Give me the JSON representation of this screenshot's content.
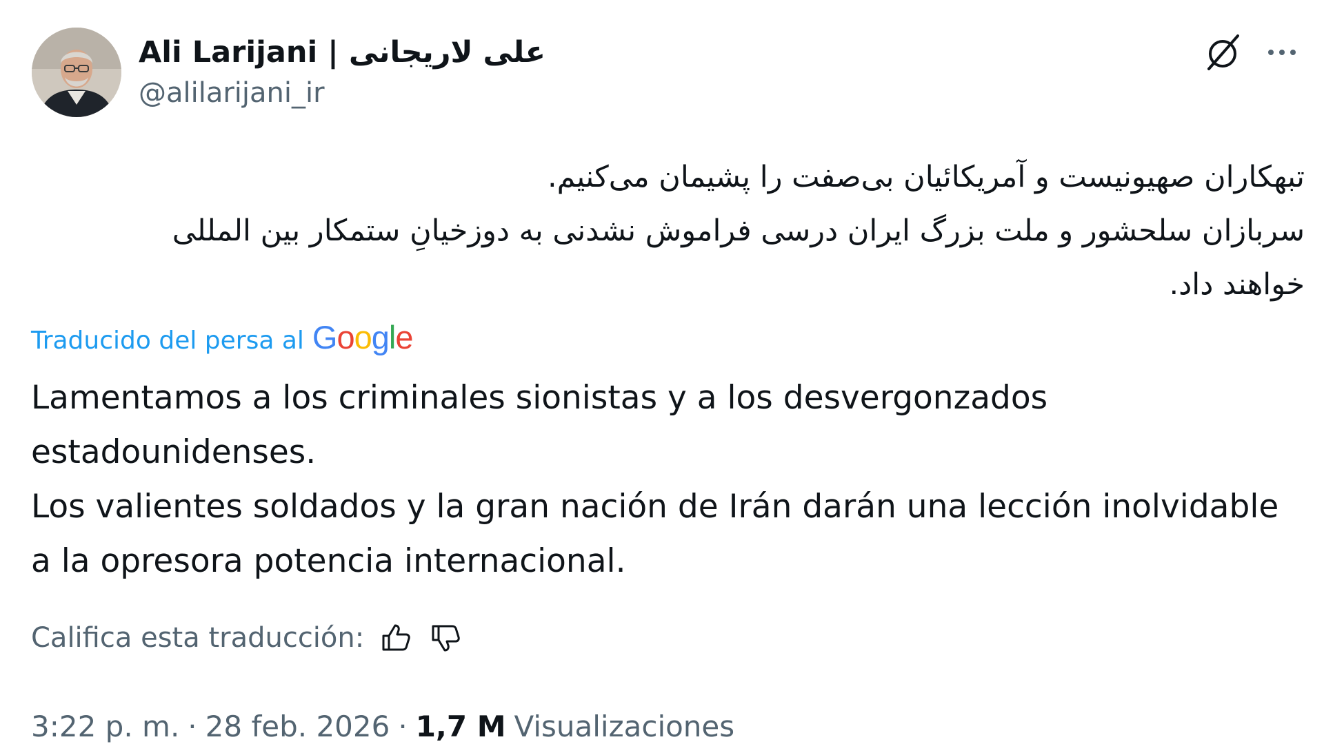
{
  "author": {
    "display_name": "Ali Larijani | علی لاریجانی",
    "handle": "@alilarijani_ir",
    "avatar_icon": "profile-photo"
  },
  "header_actions": {
    "grok_icon": "grok-icon",
    "more_icon": "more-options-icon"
  },
  "tweet": {
    "original_text": "تبهکاران صهیونیست و آمریکائیان بی‌صفت را پشیمان می‌کنیم.\nسربازان سلحشور و ملت بزرگ ایران درسی فراموش نشدنی به دوزخیانِ ستمکار بین المللی خواهند داد.",
    "translated_by_label": "Traducido del persa al",
    "translator_brand": "Google",
    "translation_text": "Lamentamos a los criminales sionistas y a los desvergonzados estadounidenses.\nLos valientes soldados y la gran nación de Irán darán una lección inolvidable a la opresora potencia internacional."
  },
  "rating": {
    "label": "Califica esta traducción:",
    "thumbs_up_icon": "thumbs-up-icon",
    "thumbs_down_icon": "thumbs-down-icon"
  },
  "meta": {
    "time": "3:22 p. m.",
    "separator": "·",
    "date": "28 feb. 2026",
    "views_count": "1,7 M",
    "views_label": "Visualizaciones"
  },
  "colors": {
    "text_primary": "#0f1419",
    "text_secondary": "#536471",
    "link_blue": "#1d9bf0",
    "google_blue": "#4285f4",
    "google_red": "#ea4335",
    "google_yellow": "#fbbc05",
    "google_green": "#34a853"
  }
}
